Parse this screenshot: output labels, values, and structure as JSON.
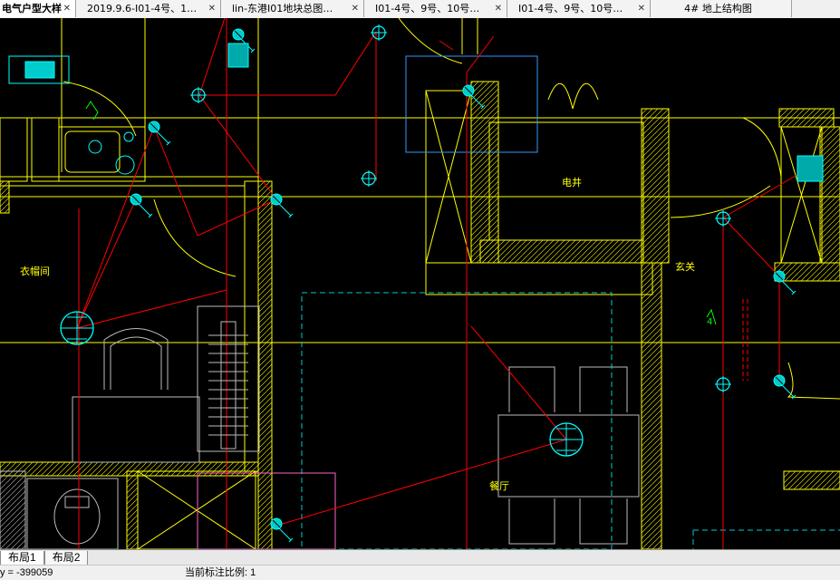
{
  "tabs": [
    {
      "label": "电气户型大样",
      "active": true
    },
    {
      "label": "2019.9.6-I01-4号、1…",
      "active": false
    },
    {
      "label": "lin-东港I01地块总图…",
      "active": false
    },
    {
      "label": "I01-4号、9号、10号…",
      "active": false
    },
    {
      "label": "I01-4号、9号、10号…",
      "active": false
    },
    {
      "label": "4# 地上结构图",
      "active": false
    }
  ],
  "close_glyph": "✕",
  "drawing": {
    "room_labels": {
      "cloakroom": "衣帽间",
      "shaft": "电井",
      "foyer": "玄关",
      "dining": "餐厅",
      "mark_4": "4"
    },
    "colors": {
      "wall": "#ffff00",
      "wire": "#ff0000",
      "device": "#00ffff",
      "dim": "#00ff00",
      "background": "#000000"
    }
  },
  "layout_tabs": [
    "布局1",
    "布局2"
  ],
  "status": {
    "coordinate": "y = -399059",
    "annotation_scale": "当前标注比例: 1"
  }
}
